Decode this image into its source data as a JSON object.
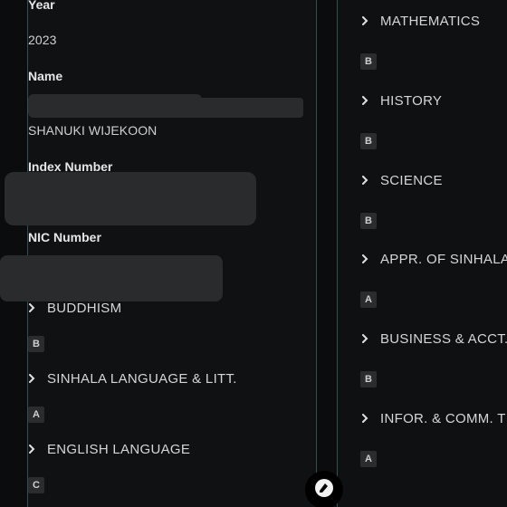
{
  "details": {
    "year_label": "Year",
    "year_value": "2023",
    "name_label": "Name",
    "name_value": "SHANUKI WIJEKOON",
    "index_label": "Index Number",
    "nic_label": "NIC Number"
  },
  "left_subjects": [
    {
      "name": "BUDDHISM",
      "grade": "B"
    },
    {
      "name": "SINHALA LANGUAGE & LITT.",
      "grade": "A"
    },
    {
      "name": "ENGLISH LANGUAGE",
      "grade": "C"
    }
  ],
  "right_subjects": [
    {
      "name": "MATHEMATICS",
      "grade": "B"
    },
    {
      "name": "HISTORY",
      "grade": "B"
    },
    {
      "name": "SCIENCE",
      "grade": "B"
    },
    {
      "name": "APPR. OF SINHALA",
      "grade": "A"
    },
    {
      "name": "BUSINESS & ACCT.",
      "grade": "B"
    },
    {
      "name": "INFOR. & COMM. T",
      "grade": "A"
    }
  ],
  "icons": {
    "chevron": "chevron-right-icon",
    "fab": "edit-icon"
  },
  "colors": {
    "panel_border": "#2f5152",
    "grade_badge": "#2b2c2e",
    "redaction": "#2a2b2d"
  }
}
